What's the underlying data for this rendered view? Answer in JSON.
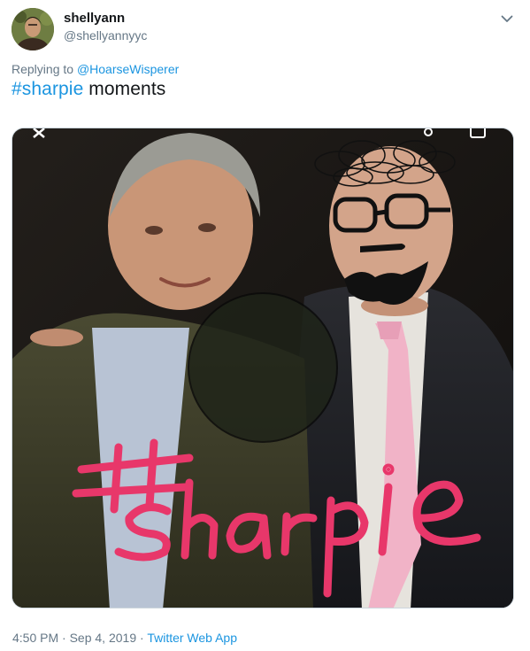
{
  "user": {
    "name": "shellyann",
    "handle": "@shellyannyyc",
    "avatar_icon": "portrait-avatar-icon"
  },
  "reply": {
    "prefix": "Replying to",
    "mention": "@HoarseWisperer"
  },
  "tweet": {
    "hashtag": "#sharpie",
    "text": " moments"
  },
  "media": {
    "drawn_text": "#sharpie"
  },
  "meta": {
    "time": "4:50 PM",
    "separator1": " · ",
    "date": "Sep 4, 2019",
    "separator2": " · ",
    "app": "Twitter Web App"
  },
  "colors": {
    "link": "#1b95e0",
    "secondary": "#657786",
    "sharpie_pink": "#e8376a"
  }
}
